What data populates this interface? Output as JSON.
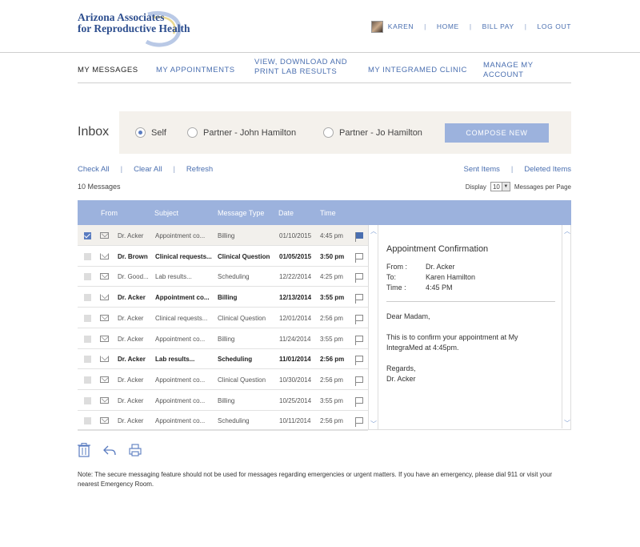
{
  "header": {
    "logo_line1": "Arizona Associates",
    "logo_line2": "for Reproductive Health",
    "user_name": "KAREN",
    "links": [
      "HOME",
      "BILL PAY",
      "LOG OUT"
    ]
  },
  "main_nav": {
    "tabs": [
      {
        "label": "MY MESSAGES",
        "active": true
      },
      {
        "label": "MY APPOINTMENTS"
      },
      {
        "label_line1": "VIEW, DOWNLOAD AND",
        "label_line2": "PRINT LAB RESULTS"
      },
      {
        "label": "MY INTEGRAMED CLINIC"
      },
      {
        "label": "MANAGE MY ACCOUNT"
      }
    ]
  },
  "inbox": {
    "title": "Inbox",
    "filters": [
      {
        "label": "Self",
        "selected": true
      },
      {
        "label": "Partner - John Hamilton",
        "selected": false
      },
      {
        "label": "Partner - Jo Hamilton",
        "selected": false
      }
    ],
    "compose_label": "COMPOSE NEW"
  },
  "actions": {
    "check_all": "Check All",
    "clear_all": "Clear All",
    "refresh": "Refresh",
    "sent_items": "Sent Items",
    "deleted_items": "Deleted Items"
  },
  "count_text": "10 Messages",
  "display": {
    "prefix": "Display",
    "value": "10",
    "suffix": "Messages per Page"
  },
  "columns": [
    "From",
    "Subject",
    "Message Type",
    "Date",
    "Time"
  ],
  "messages": [
    {
      "checked": true,
      "selected": true,
      "unread": false,
      "envelope": "closed",
      "from": "Dr. Acker",
      "subject": "Appointment co...",
      "type": "Billing",
      "date": "01/10/2015",
      "time": "4:45 pm",
      "flagged": true
    },
    {
      "checked": false,
      "unread": true,
      "envelope": "open",
      "from": "Dr. Brown",
      "subject": "Clinical requests...",
      "type": "Clinical Question",
      "date": "01/05/2015",
      "time": "3:50 pm",
      "flagged": false
    },
    {
      "checked": false,
      "unread": false,
      "envelope": "closed",
      "from": "Dr. Good...",
      "subject": "Lab results...",
      "type": "Scheduling",
      "date": "12/22/2014",
      "time": "4:25 pm",
      "flagged": false
    },
    {
      "checked": false,
      "unread": true,
      "envelope": "open",
      "from": "Dr. Acker",
      "subject": "Appointment co...",
      "type": "Billing",
      "date": "12/13/2014",
      "time": "3:55 pm",
      "flagged": false
    },
    {
      "checked": false,
      "unread": false,
      "envelope": "closed",
      "from": "Dr. Acker",
      "subject": "Clinical requests...",
      "type": "Clinical Question",
      "date": "12/01/2014",
      "time": "2:56 pm",
      "flagged": false
    },
    {
      "checked": false,
      "unread": false,
      "envelope": "closed",
      "from": "Dr. Acker",
      "subject": "Appointment co...",
      "type": "Billing",
      "date": "11/24/2014",
      "time": "3:55 pm",
      "flagged": false
    },
    {
      "checked": false,
      "unread": true,
      "envelope": "open",
      "from": "Dr. Acker",
      "subject": "Lab results...",
      "type": "Scheduling",
      "date": "11/01/2014",
      "time": "2:56 pm",
      "flagged": false
    },
    {
      "checked": false,
      "unread": false,
      "envelope": "closed",
      "from": "Dr. Acker",
      "subject": "Appointment co...",
      "type": "Clinical Question",
      "date": "10/30/2014",
      "time": "2:56 pm",
      "flagged": false
    },
    {
      "checked": false,
      "unread": false,
      "envelope": "closed",
      "from": "Dr. Acker",
      "subject": "Appointment co...",
      "type": "Billing",
      "date": "10/25/2014",
      "time": "3:55 pm",
      "flagged": false
    },
    {
      "checked": false,
      "unread": false,
      "envelope": "closed",
      "from": "Dr. Acker",
      "subject": "Appointment co...",
      "type": "Scheduling",
      "date": "10/11/2014",
      "time": "2:56 pm",
      "flagged": false
    }
  ],
  "preview": {
    "title": "Appointment Confirmation",
    "from_label": "From :",
    "from_value": "Dr. Acker",
    "to_label": "To:",
    "to_value": "Karen Hamilton",
    "time_label": "Time :",
    "time_value": "4:45 PM",
    "greeting": "Dear Madam,",
    "body_line1": "This is to confirm your appointment at My",
    "body_line2": "IntegraMed at 4:45pm.",
    "closing": "Regards,",
    "signature": "Dr. Acker"
  },
  "tools": [
    "trash-icon",
    "reply-icon",
    "print-icon"
  ],
  "note": "Note: The secure messaging feature should not be used for messages regarding emergencies or urgent matters. If you have an emergency, please dial 911 or visit your nearest Emergency Room.",
  "colors": {
    "accent": "#9cb2dd",
    "link": "#4a6fb0",
    "panel_bg": "#f4f1ec"
  }
}
